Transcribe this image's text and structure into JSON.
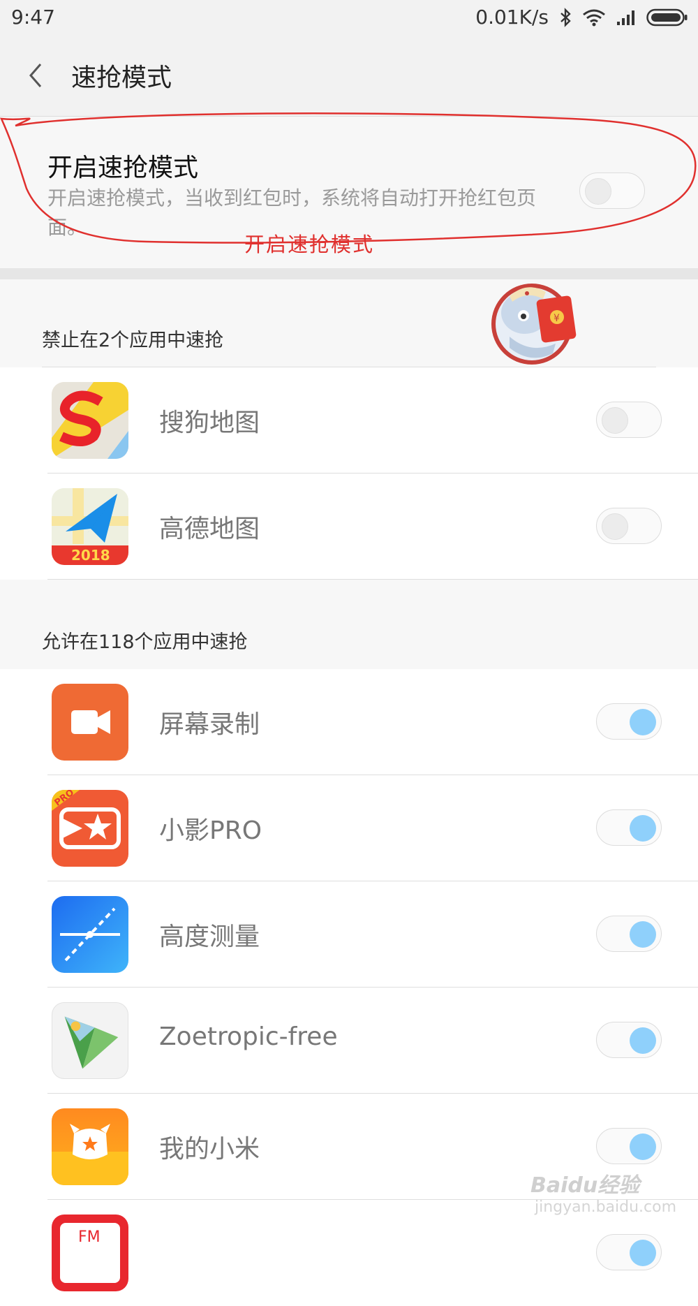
{
  "status": {
    "time": "9:47",
    "net_speed": "0.01K/s",
    "icons": [
      "bluetooth-icon",
      "wifi-icon",
      "signal-icon",
      "battery-icon"
    ]
  },
  "app_bar": {
    "title": "速抢模式",
    "back_icon": "chevron-left-icon"
  },
  "master": {
    "title": "开启速抢模式",
    "description": "开启速抢模式，当收到红包时，系统将自动打开抢红包页面。",
    "enabled": false,
    "annotation": "开启速抢模式"
  },
  "blocked": {
    "header": "禁止在2个应用中速抢",
    "apps": [
      {
        "name": "搜狗地图",
        "enabled": false,
        "icon": "sogou-map-icon"
      },
      {
        "name": "高德地图",
        "enabled": false,
        "icon": "amap-icon",
        "icon_text": "2018"
      }
    ]
  },
  "allowed": {
    "header": "允许在118个应用中速抢",
    "apps": [
      {
        "name": "屏幕录制",
        "enabled": true,
        "icon": "screen-record-icon"
      },
      {
        "name": "小影PRO",
        "enabled": true,
        "icon": "xiaoying-pro-icon",
        "icon_text": "PRO"
      },
      {
        "name": "高度测量",
        "enabled": true,
        "icon": "height-measure-icon"
      },
      {
        "name": "Zoetropic-free",
        "enabled": true,
        "icon": "zoetropic-icon"
      },
      {
        "name": "我的小米",
        "enabled": true,
        "icon": "my-xiaomi-icon"
      },
      {
        "name": "",
        "enabled": true,
        "icon": "fm-radio-icon",
        "icon_text": "FM"
      }
    ]
  },
  "watermark": {
    "brand": "Baidu经验",
    "url": "jingyan.baidu.com"
  },
  "colors": {
    "toggle_on": "#8fd0fb",
    "annotation_red": "#e0302e"
  }
}
